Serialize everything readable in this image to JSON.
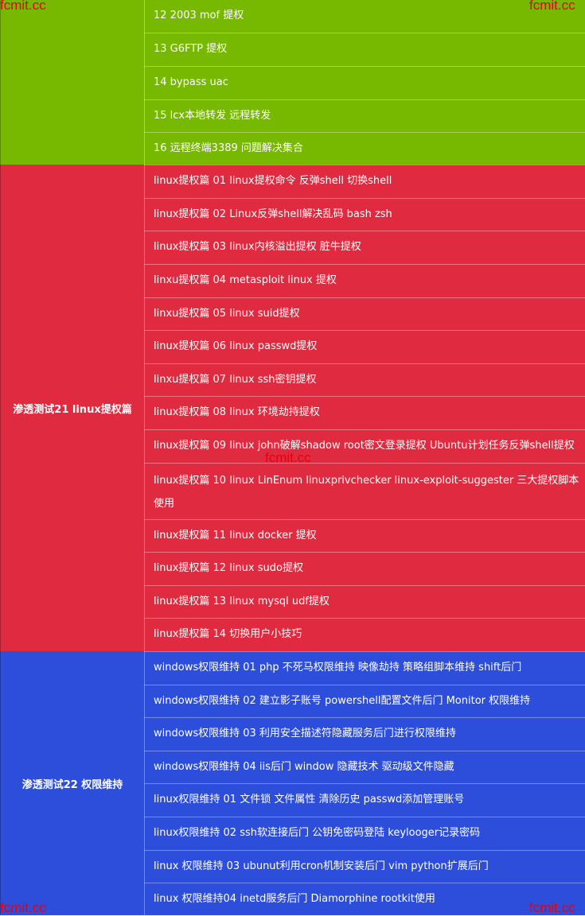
{
  "colors": {
    "green": "#77b800",
    "red": "#e02a3f",
    "blue": "#2d4edb",
    "watermark": "#e60012"
  },
  "watermarks": [
    "fcmit.cc",
    "fcmit.cc",
    "fcmit.cc",
    "fcmit.cc",
    "fcmit.cc"
  ],
  "sections": [
    {
      "category": "",
      "rows": [
        "12 2003 mof 提权",
        "13 G6FTP 提权",
        "14 bypass uac",
        "15 lcx本地转发 远程转发",
        "16 远程终端3389 问题解决集合"
      ]
    },
    {
      "category": "渗透测试21 linux提权篇",
      "rows": [
        "linux提权篇 01 linux提权命令 反弹shell 切换shell",
        "linux提权篇 02 Linux反弹shell解决乱码 bash zsh",
        "linux提权篇 03 linux内核溢出提权 脏牛提权",
        "linxu提权篇 04 metasploit linux 提权",
        "linxu提权篇 05 linux suid提权",
        "linux提权篇 06 linux passwd提权",
        "linxu提权篇 07 linux ssh密钥提权",
        "linux提权篇 08 linux 环境劫持提权",
        "linux提权篇 09 linux john破解shadow root密文登录提权 Ubuntu计划任务反弹shell提权",
        "linux提权篇 10 linux LinEnum linuxprivchecker linux-exploit-suggester 三大提权脚本使用",
        "linux提权篇 11 linux docker 提权",
        "linux提权篇 12 linux sudo提权",
        "linux提权篇 13 linux mysql udf提权",
        "linux提权篇 14 切换用户小技巧"
      ]
    },
    {
      "category": "渗透测试22 权限维持",
      "rows": [
        "windows权限维持 01 php 不死马权限维持 映像劫持 策略组脚本维持 shift后门",
        "windows权限维持 02 建立影子账号 powershell配置文件后门 Monitor 权限维持",
        "windows权限维持 03 利用安全描述符隐藏服务后门进行权限维持",
        "windows权限维持 04 iis后门 window 隐藏技术 驱动级文件隐藏",
        "linux权限维持 01 文件锁 文件属性 清除历史 passwd添加管理账号",
        "linux权限维持 02 ssh软连接后门 公钥免密码登陆 keylooger记录密码",
        "linux 权限维持 03 ubunut利用cron机制安装后门 vim python扩展后门",
        "linux 权限维持04 inetd服务后门 Diamorphine rootkit使用"
      ]
    }
  ]
}
